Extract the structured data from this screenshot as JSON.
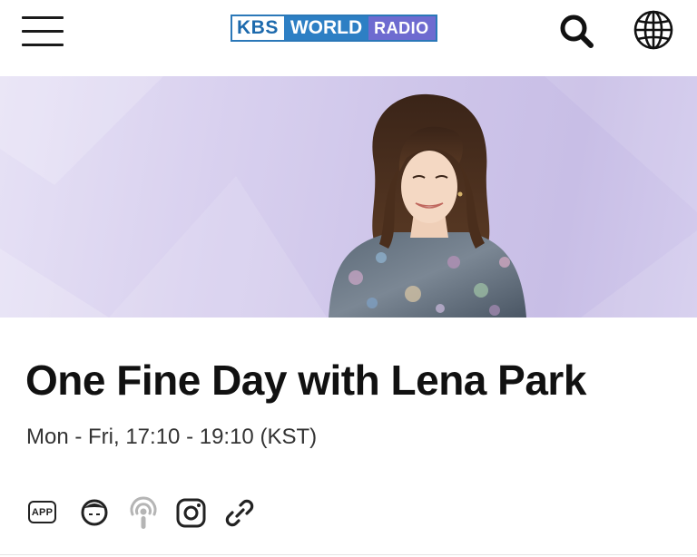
{
  "header": {
    "logo": {
      "kbs": "KBS",
      "world": "WORLD",
      "radio": "RADIO"
    },
    "icons": {
      "menu": "hamburger-menu-icon",
      "search": "search-icon",
      "language": "globe-icon"
    }
  },
  "hero": {
    "image": "program-host-portrait",
    "background_color": "#d3cbed"
  },
  "program": {
    "title": "One Fine Day with Lena Park",
    "schedule": "Mon - Fri, 17:10 - 19:10 (KST)"
  },
  "links": {
    "app_label": "APP",
    "icons": [
      "app-icon",
      "kakao-icon",
      "podcast-icon",
      "instagram-icon",
      "link-icon"
    ]
  },
  "colors": {
    "kbs_blue": "#1d6aad",
    "world_blue": "#2d7fc4",
    "radio_purple": "#6e6bd0",
    "hero_lavender": "#d3cbed"
  }
}
